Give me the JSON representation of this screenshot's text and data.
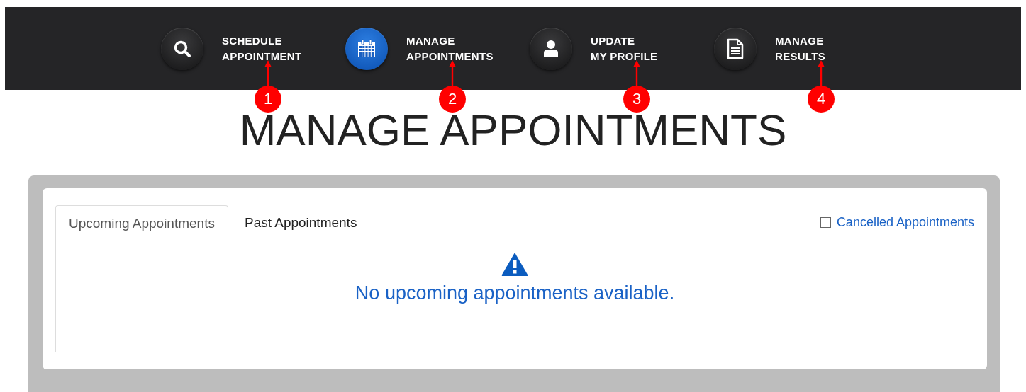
{
  "nav": [
    {
      "lines": [
        "SCHEDULE",
        "APPOINTMENT"
      ],
      "selected": false,
      "callout": "1"
    },
    {
      "lines": [
        "MANAGE",
        "APPOINTMENTS"
      ],
      "selected": true,
      "callout": "2"
    },
    {
      "lines": [
        "UPDATE",
        "MY PROFILE"
      ],
      "selected": false,
      "callout": "3"
    },
    {
      "lines": [
        "MANAGE",
        "RESULTS"
      ],
      "selected": false,
      "callout": "4"
    }
  ],
  "title": "MANAGE APPOINTMENTS",
  "tabs": [
    {
      "label": "Upcoming Appointments",
      "selected": true
    },
    {
      "label": "Past Appointments",
      "selected": false
    }
  ],
  "filter": {
    "label": "Cancelled Appointments",
    "checked": false
  },
  "message": "No upcoming appointments available."
}
